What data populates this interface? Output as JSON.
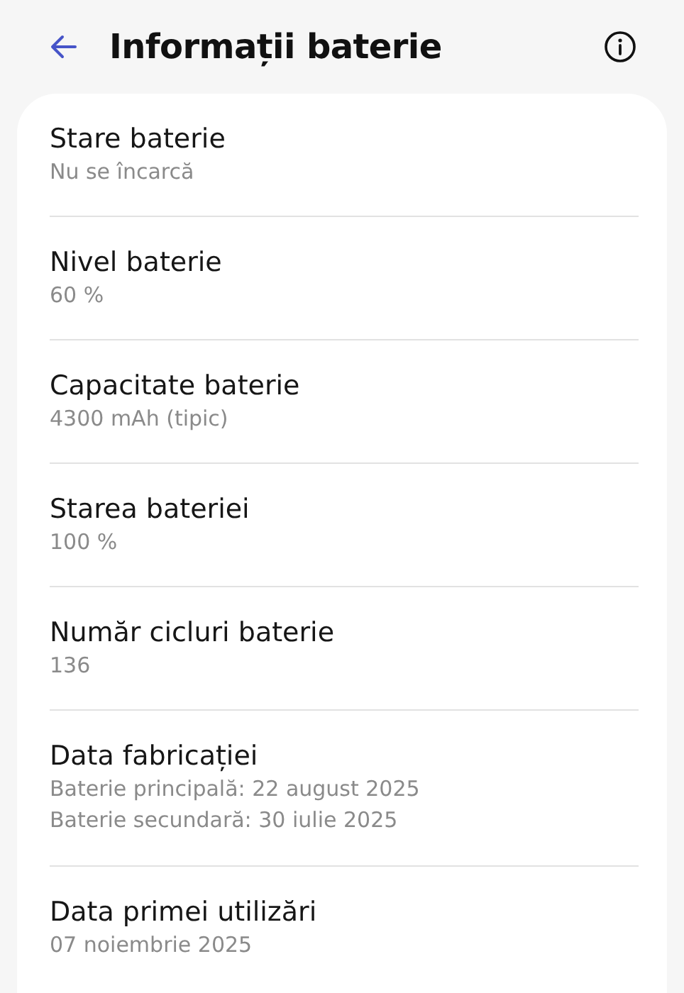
{
  "header": {
    "title": "Informații baterie"
  },
  "items": [
    {
      "title": "Stare baterie",
      "values": [
        "Nu se încarcă"
      ]
    },
    {
      "title": "Nivel baterie",
      "values": [
        "60 %"
      ]
    },
    {
      "title": "Capacitate baterie",
      "values": [
        "4300 mAh (tipic)"
      ]
    },
    {
      "title": "Starea bateriei",
      "values": [
        "100 %"
      ]
    },
    {
      "title": "Număr cicluri baterie",
      "values": [
        "136"
      ]
    },
    {
      "title": "Data fabricației",
      "values": [
        "Baterie principală: 22 august 2025",
        "Baterie secundară: 30 iulie 2025"
      ]
    },
    {
      "title": "Data primei utilizări",
      "values": [
        "07 noiembrie 2025"
      ]
    }
  ]
}
